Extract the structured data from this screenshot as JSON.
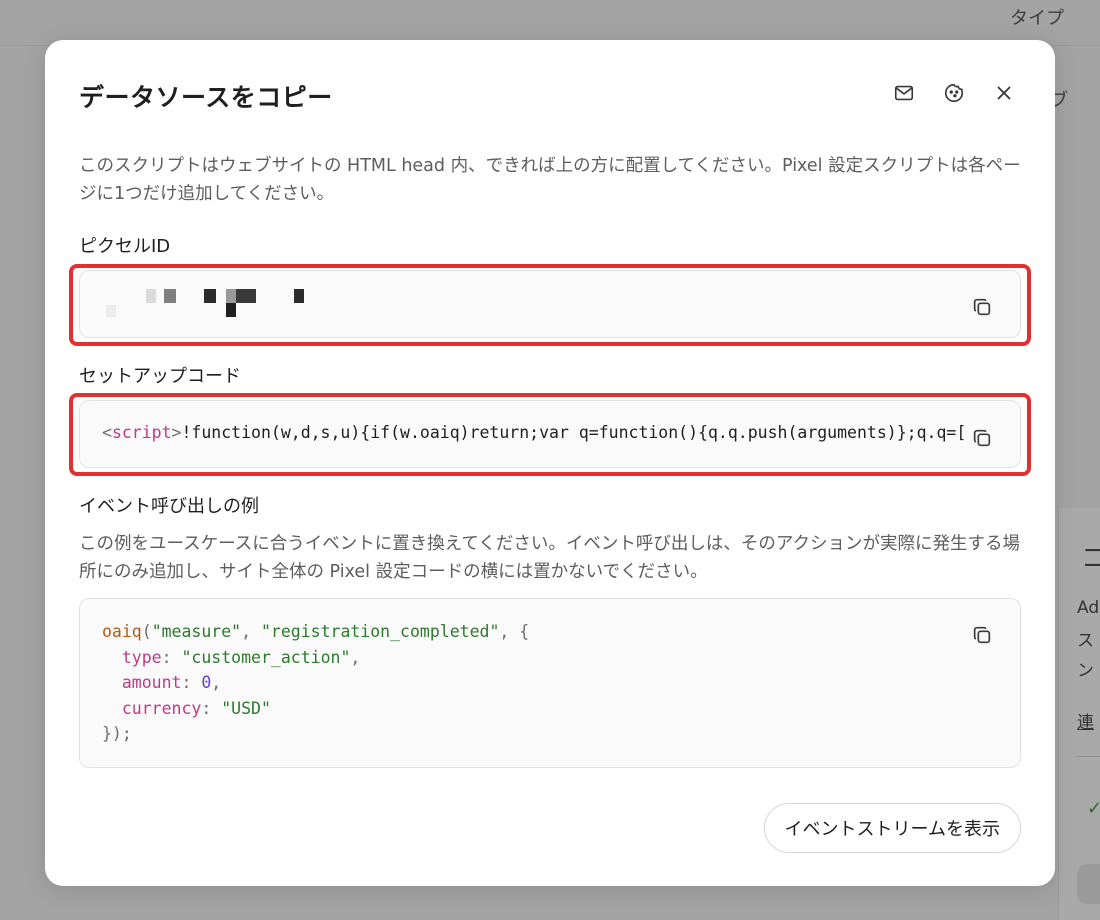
{
  "background": {
    "header_text": "タイプ",
    "side_text": "ブ",
    "card_lines": [
      "コ",
      "Ad",
      "ス",
      "ン",
      "連"
    ]
  },
  "modal": {
    "title": "データソースをコピー",
    "header_icons": [
      "mail-icon",
      "cookie-icon",
      "close-icon"
    ],
    "description": "このスクリプトはウェブサイトの HTML head 内、できれば上の方に配置してください。Pixel 設定スクリプトは各ページに1つだけ追加してください。",
    "pixel_id": {
      "label": "ピクセルID"
    },
    "setup_code": {
      "label": "セットアップコード",
      "open_bracket": "<",
      "tag": "script",
      "close_bracket": ">",
      "body": "!function(w,d,s,u){if(w.oaiq)return;var q=function(){q.q.push(arguments)};q.q=[]"
    },
    "example": {
      "label": "イベント呼び出しの例",
      "description": "この例をユースケースに合うイベントに置き換えてください。イベント呼び出しは、そのアクションが実際に発生する場所にのみ追加し、サイト全体の Pixel 設定コードの横には置かないでください。",
      "fn": "oaiq",
      "arg1": "\"measure\"",
      "arg2": "\"registration_completed\"",
      "key_type": "type",
      "val_type": "\"customer_action\"",
      "key_amount": "amount",
      "val_amount": "0",
      "key_currency": "currency",
      "val_currency": "\"USD\"",
      "closing": "});"
    },
    "view_stream_button": "イベントストリームを表示"
  },
  "colors": {
    "highlight": "#e03131",
    "code_tag": "#c0398a",
    "code_string": "#2c7a2c",
    "code_function": "#b55a10",
    "code_number": "#6a3fc4"
  }
}
